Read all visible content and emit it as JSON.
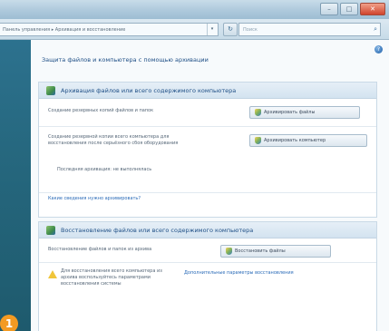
{
  "window": {
    "minimize": "–",
    "maximize": "□",
    "close": "✕"
  },
  "address": {
    "path": "Панель управления ▸ Архивация и восстановление",
    "dropdown": "▾"
  },
  "search": {
    "placeholder": "Поиск",
    "icon": "search-icon"
  },
  "page": {
    "heading": "Защита файлов и компьютера с помощью архивации",
    "help": "?"
  },
  "backup_group": {
    "title": "Архивация файлов или всего содержимого компьютера",
    "row1_text": "Создание резервных копий файлов и папок",
    "row1_button": "Архивировать файлы",
    "row2_text": "Создание резервной копии всего компьютера для восстановления после серьёзного сбоя оборудования",
    "row2_button": "Архивировать компьютер",
    "row2_note": "Последняя архивация: не выполнялась",
    "link": "Какие сведения нужно архивировать?"
  },
  "restore_group": {
    "title": "Восстановление файлов или всего содержимого компьютера",
    "row1_text": "Восстановление файлов и папок из архива",
    "row1_button": "Восстановить файлы",
    "row2_text": "Для восстановления всего компьютера из архива воспользуйтесь параметрами восстановления системы",
    "row2_link": "Дополнительные параметры восстановления"
  },
  "badge": {
    "number": "1"
  }
}
